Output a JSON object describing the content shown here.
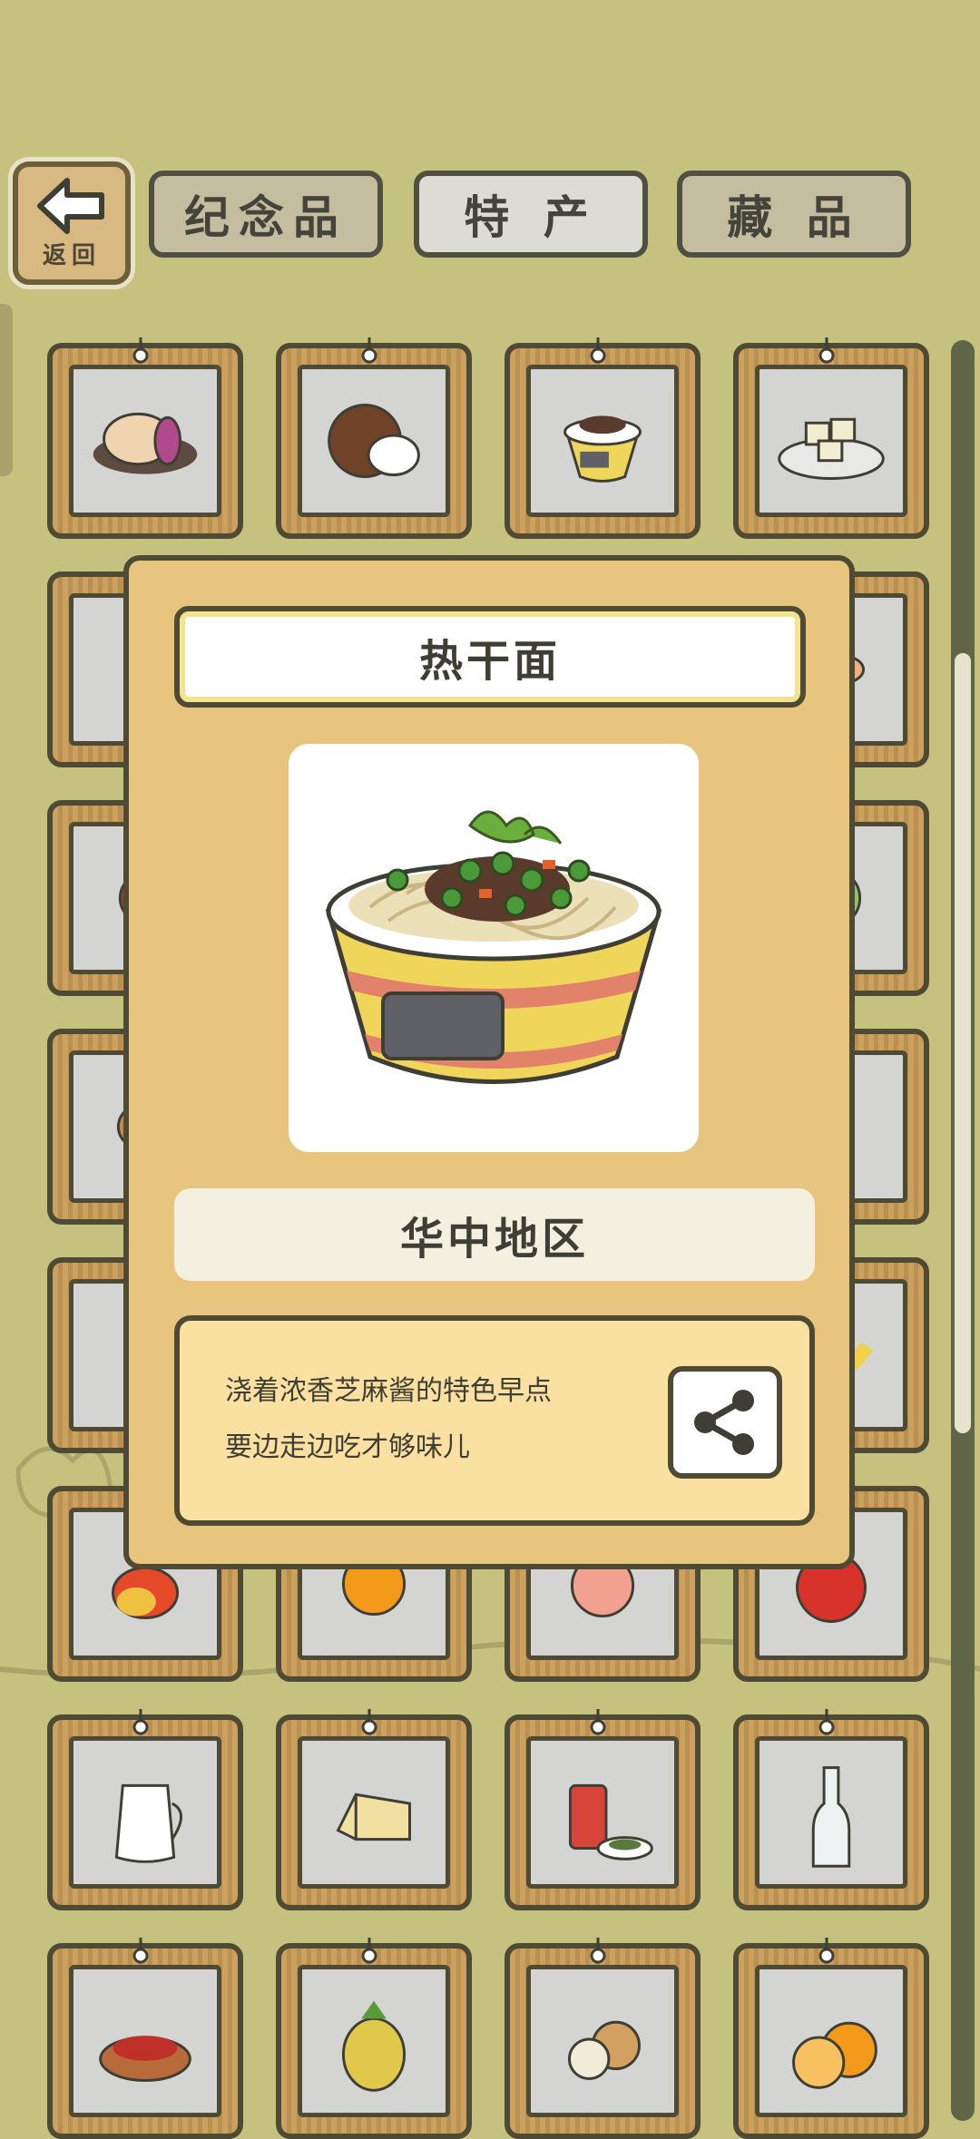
{
  "header": {
    "back_label": "返回",
    "tabs": [
      {
        "label": "纪念品",
        "active": false
      },
      {
        "label": "特 产",
        "active": true
      },
      {
        "label": "藏 品",
        "active": false
      }
    ]
  },
  "grid": {
    "items": [
      "mooncake-icon",
      "coconut-icon",
      "hot-dry-noodles-icon",
      "tofu-icon",
      "tomato-dish-icon",
      "",
      "",
      "soup-bowl-icon",
      "meat-dish-icon",
      "",
      "",
      "cabbage-icon",
      "potato-icon",
      "",
      "",
      "chili-icon",
      "strawberry-icon",
      "",
      "",
      "banana-icon",
      "mango-icon",
      "orange-icon",
      "peach-icon",
      "apple-icon",
      "milk-jug-icon",
      "cheese-icon",
      "tea-can-icon",
      "glass-bottle-icon",
      "goji-berries-icon",
      "horned-melon-icon",
      "longan-icon",
      "orange-slice-icon"
    ]
  },
  "modal": {
    "name": "热干面",
    "image": "hot-dry-noodles",
    "region": "华中地区",
    "description_line1": "浇着浓香芝麻酱的特色早点",
    "description_line2": "要边走边吃才够味儿",
    "share_icon": "share-icon"
  },
  "colors": {
    "background": "#c5c17f",
    "modal": "#e8c57e",
    "frame": "#4f4a33"
  }
}
